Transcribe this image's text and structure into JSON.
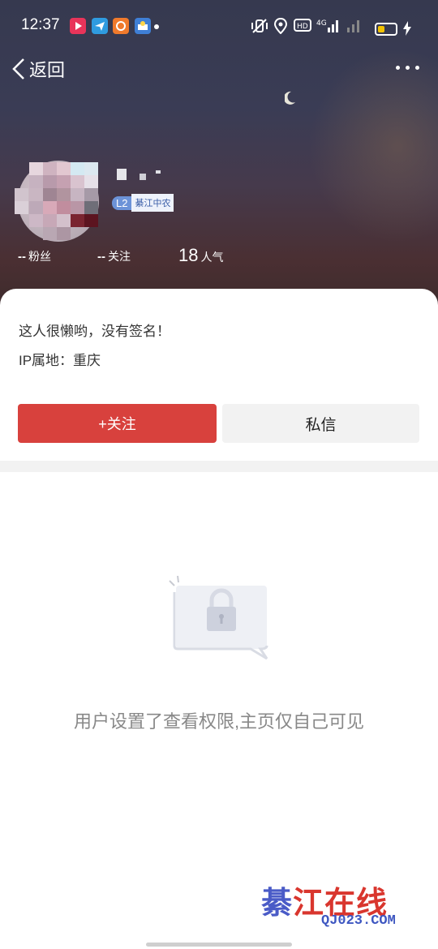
{
  "status_bar": {
    "time": "12:37",
    "network": "4G",
    "icons": [
      "video-app-icon",
      "telegram-icon",
      "store-app-icon",
      "weather-app-icon",
      "notification-dot",
      "vibrate-icon",
      "location-icon",
      "hd-icon",
      "signal-icon",
      "battery-icon",
      "charging-icon"
    ]
  },
  "nav": {
    "back_label": "返回",
    "more_icon": "more-icon"
  },
  "profile": {
    "level": "L2",
    "tag": "綦江中农",
    "stats": [
      {
        "value": "--",
        "label": "粉丝"
      },
      {
        "value": "--",
        "label": "关注"
      },
      {
        "value": "18",
        "label": "人气"
      }
    ]
  },
  "bio": {
    "signature": "这人很懒哟，没有签名！",
    "ip_location": "IP属地：重庆"
  },
  "actions": {
    "follow_label": "+关注",
    "message_label": "私信"
  },
  "empty_state": {
    "icon": "lock-icon",
    "text": "用户设置了查看权限,主页仅自己可见"
  },
  "watermark": {
    "first_char": "綦",
    "rest": "江在线",
    "url": "QJ023.COM"
  },
  "colors": {
    "accent": "#d8413d",
    "secondary_button": "#f2f2f2",
    "level_badge": "#6c93d8"
  }
}
